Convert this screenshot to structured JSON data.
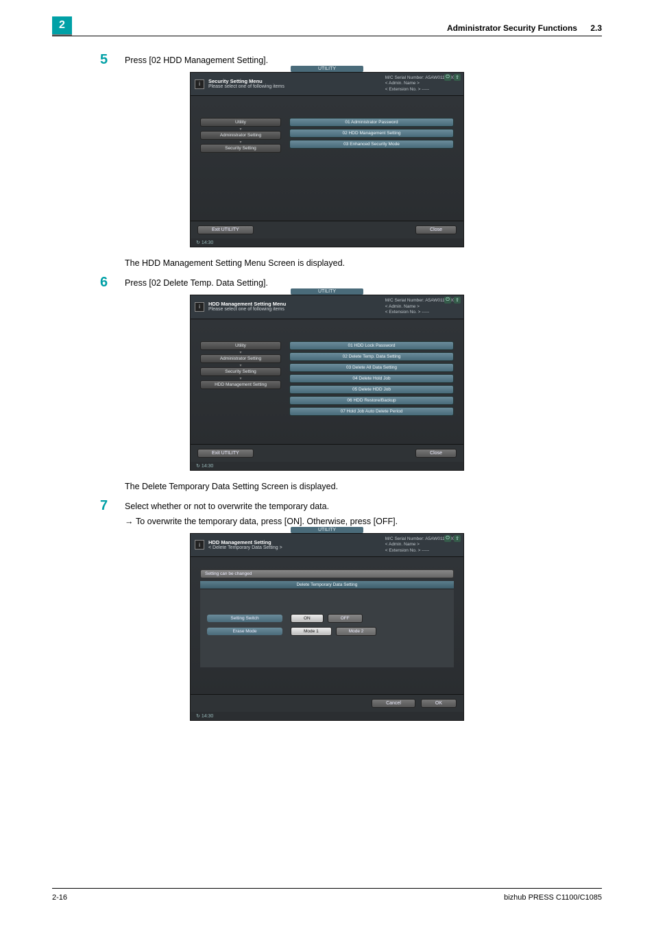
{
  "page_number_badge": "2",
  "header": {
    "title": "Administrator Security Functions",
    "section": "2.3"
  },
  "steps": {
    "s5": {
      "num": "5",
      "text": "Press [02 HDD Management Setting]."
    },
    "after5": "The HDD Management Setting Menu Screen is displayed.",
    "s6": {
      "num": "6",
      "text": "Press [02 Delete Temp. Data Setting]."
    },
    "after6": "The Delete Temporary Data Setting Screen is displayed.",
    "s7": {
      "num": "7",
      "text": "Select whether or not to overwrite the temporary data."
    },
    "sub7": "To overwrite the temporary data, press [ON]. Otherwise, press [OFF]."
  },
  "shot_common": {
    "util_label": "UTILITY",
    "serial": "M/C Serial Number: A5AW011000011",
    "admin_name": "< Admin. Name >",
    "ext": "< Extension No. >  -----",
    "exit": "Exit UTILITY",
    "close": "Close",
    "time": "14:30"
  },
  "shot1": {
    "title_bold": "Security Setting Menu",
    "title_sub": "Please select one of following items",
    "crumbs": [
      "Utility",
      "Administrator Setting",
      "Security Setting"
    ],
    "menu": [
      "01 Administrator Password",
      "02 HDD Management Setting",
      "03 Enhanced Security Mode"
    ]
  },
  "shot2": {
    "title_bold": "HDD Management Setting Menu",
    "title_sub": "Please select one of following items",
    "crumbs": [
      "Utility",
      "Administrator Setting",
      "Security Setting",
      "HDD Management Setting"
    ],
    "menu": [
      "01 HDD Lock Password",
      "02 Delete Temp. Data Setting",
      "03 Delete All Data Setting",
      "04 Delete Hold Job",
      "05 Delete HDD Job",
      "06 HDD Restore/Backup",
      "07 Hold Job Auto Delete Period"
    ]
  },
  "shot3": {
    "title_bold": "HDD Management Setting",
    "title_sub": "< Delete Temporary Data Setting >",
    "change_bar": "Setting can be changed",
    "panel_title": "Delete Temporary Data Setting",
    "row1_label": "Setting Switch",
    "row1_opts": [
      "ON",
      "OFF"
    ],
    "row2_label": "Erase Mode",
    "row2_opts": [
      "Mode 1",
      "Mode 2"
    ],
    "cancel": "Cancel",
    "ok": "OK"
  },
  "footer": {
    "left": "2-16",
    "right": "bizhub PRESS C1100/C1085"
  }
}
